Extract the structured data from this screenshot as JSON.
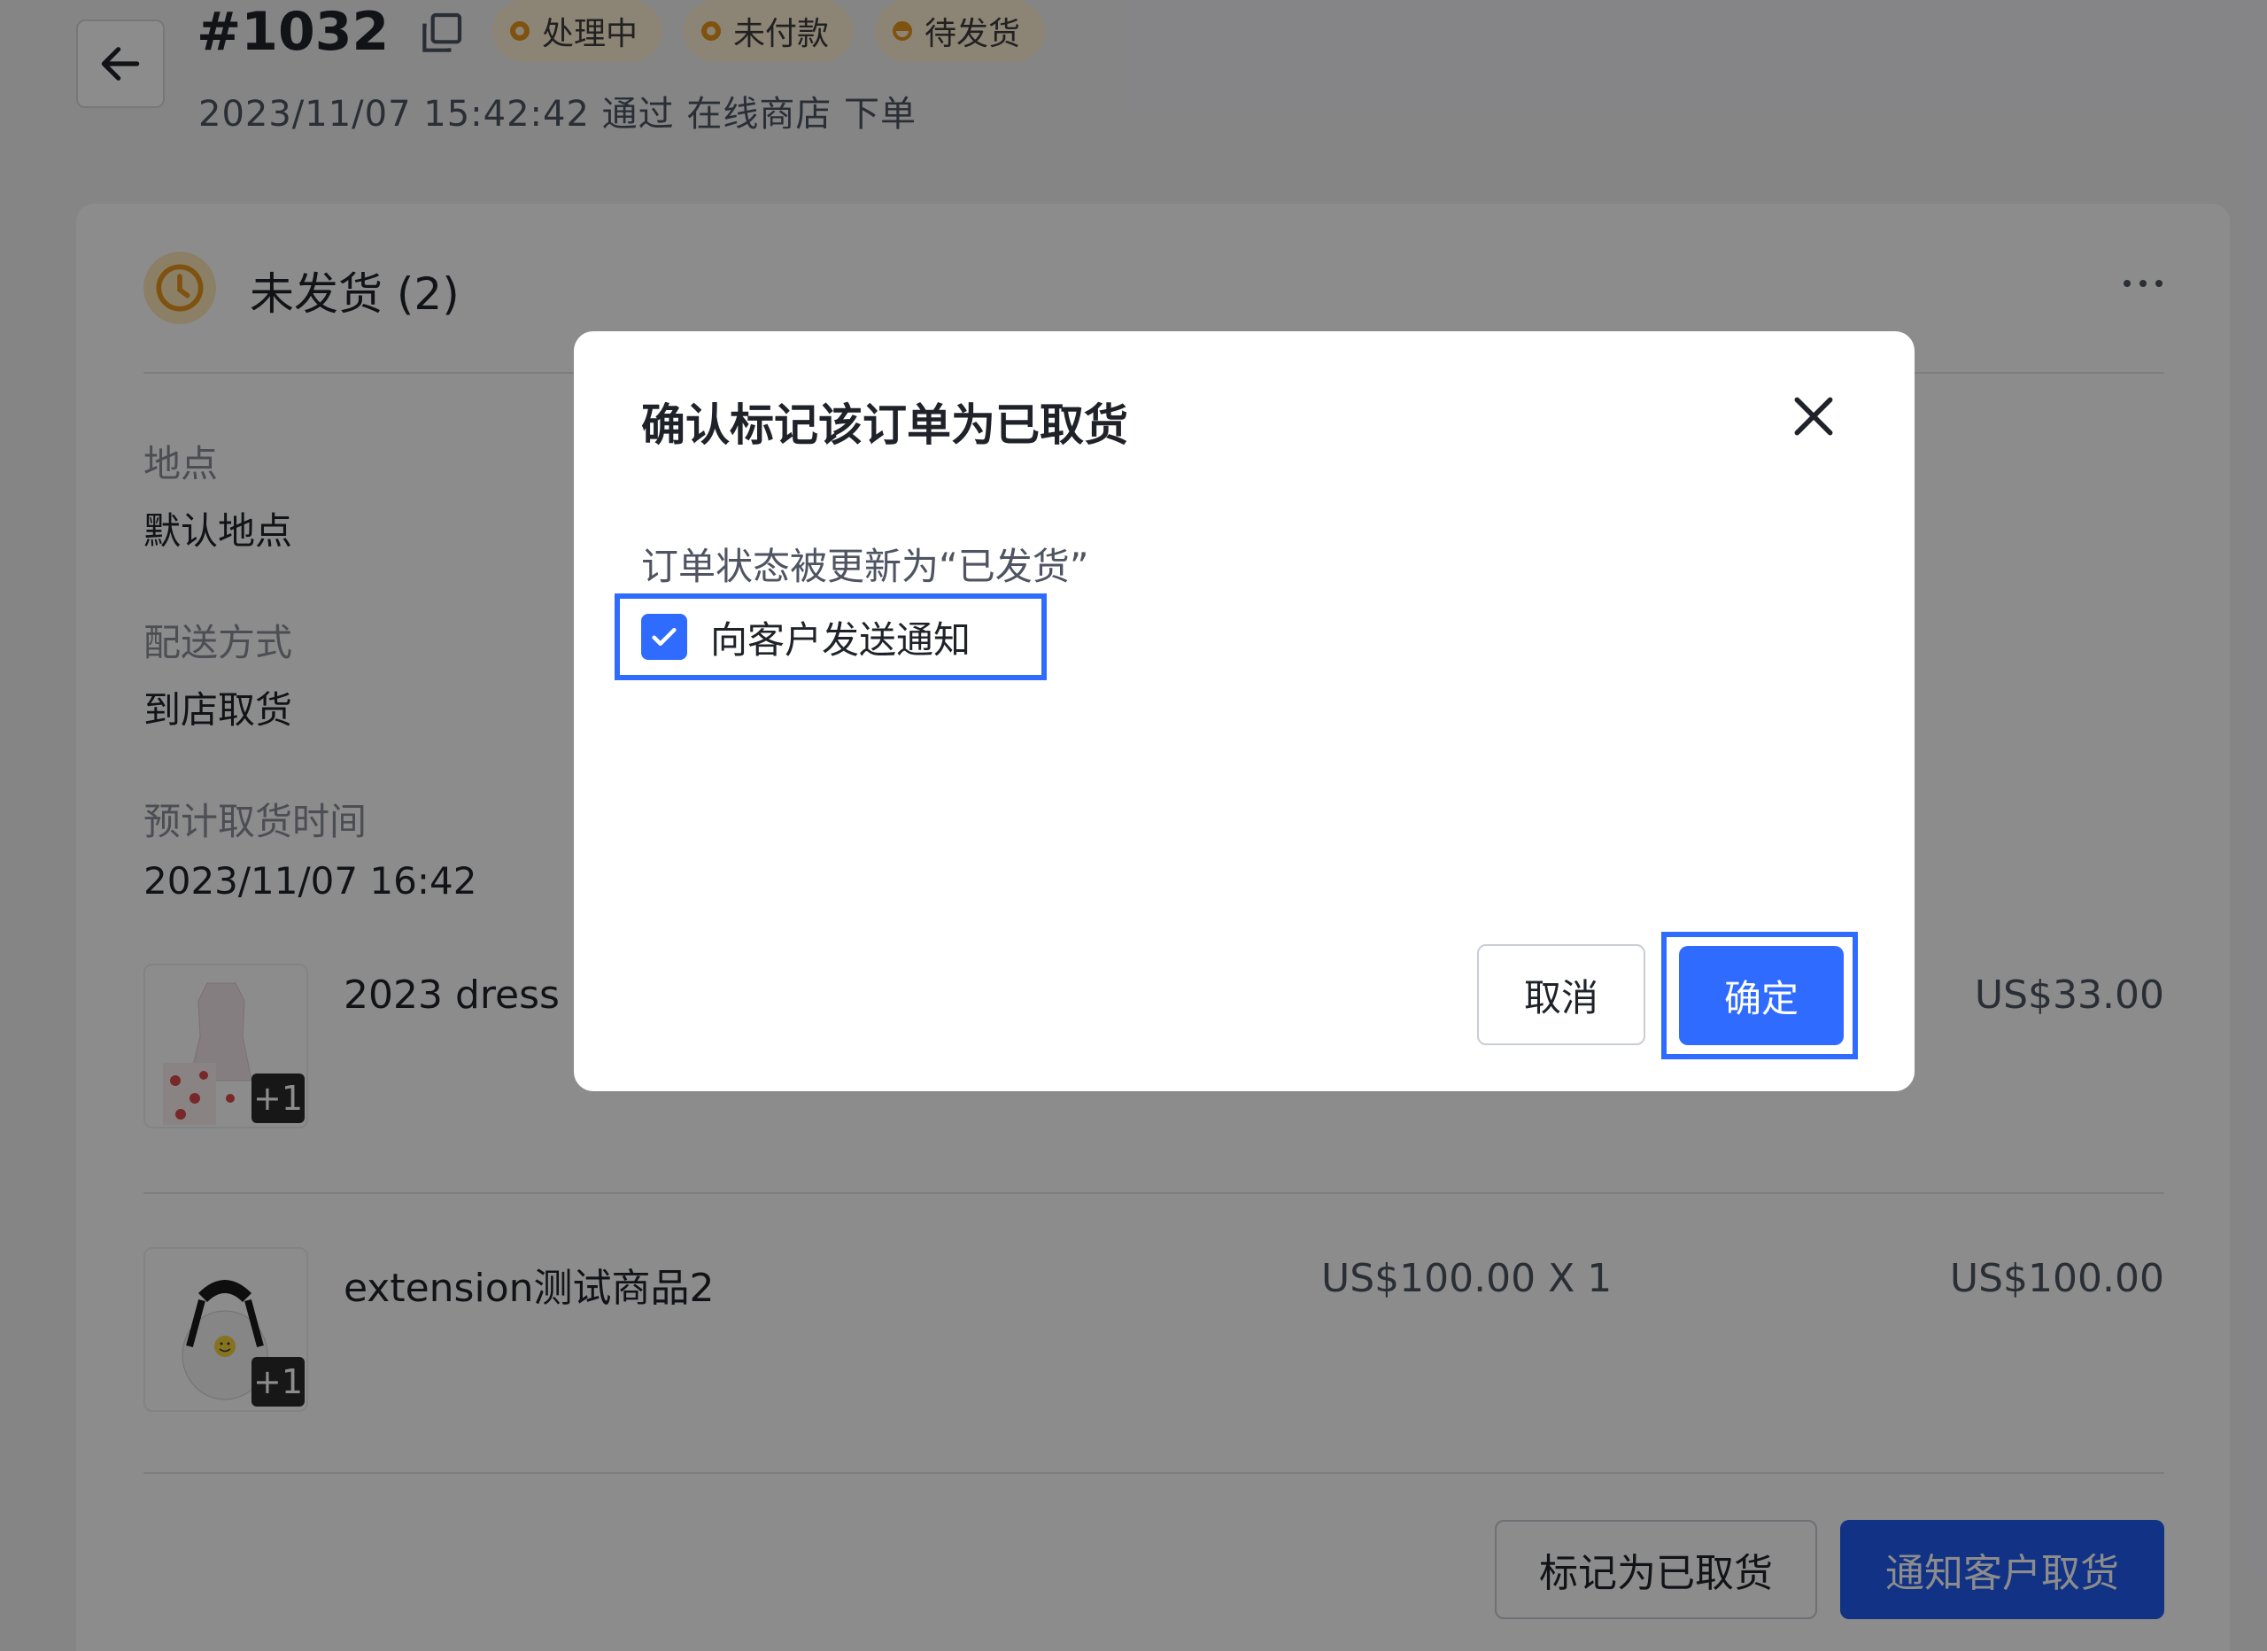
{
  "header": {
    "order_number": "#1032",
    "badges": [
      {
        "label": "处理中",
        "color": "#e8961c"
      },
      {
        "label": "未付款",
        "color": "#e8961c"
      },
      {
        "label": "待发货",
        "color": "#e8961c"
      }
    ],
    "subtitle": "2023/11/07 15:42:42 通过 在线商店 下单"
  },
  "card": {
    "title": "未发货 (2)",
    "location_label": "地点",
    "location_value": "默认地点",
    "shipping_label": "配送方式",
    "shipping_value": "到店取货",
    "pickup_time_label": "预计取货时间",
    "pickup_time_value": "2023/11/07 16:42",
    "items": [
      {
        "name": "2023 dress",
        "unit": "",
        "total": "US$33.00",
        "extra_count": "+1"
      },
      {
        "name": "extension测试商品2",
        "unit": "US$100.00 X 1",
        "total": "US$100.00",
        "extra_count": "+1"
      }
    ],
    "mark_picked_up_label": "标记为已取货",
    "notify_customer_label": "通知客户取货"
  },
  "modal": {
    "title": "确认标记该订单为已取货",
    "description": "订单状态被更新为“已发货”",
    "checkbox_label": "向客户发送通知",
    "checkbox_checked": true,
    "cancel_label": "取消",
    "confirm_label": "确定"
  },
  "colors": {
    "primary": "#2f6bff",
    "badge_bg": "#fff1d6",
    "badge_dot": "#e8961c"
  }
}
